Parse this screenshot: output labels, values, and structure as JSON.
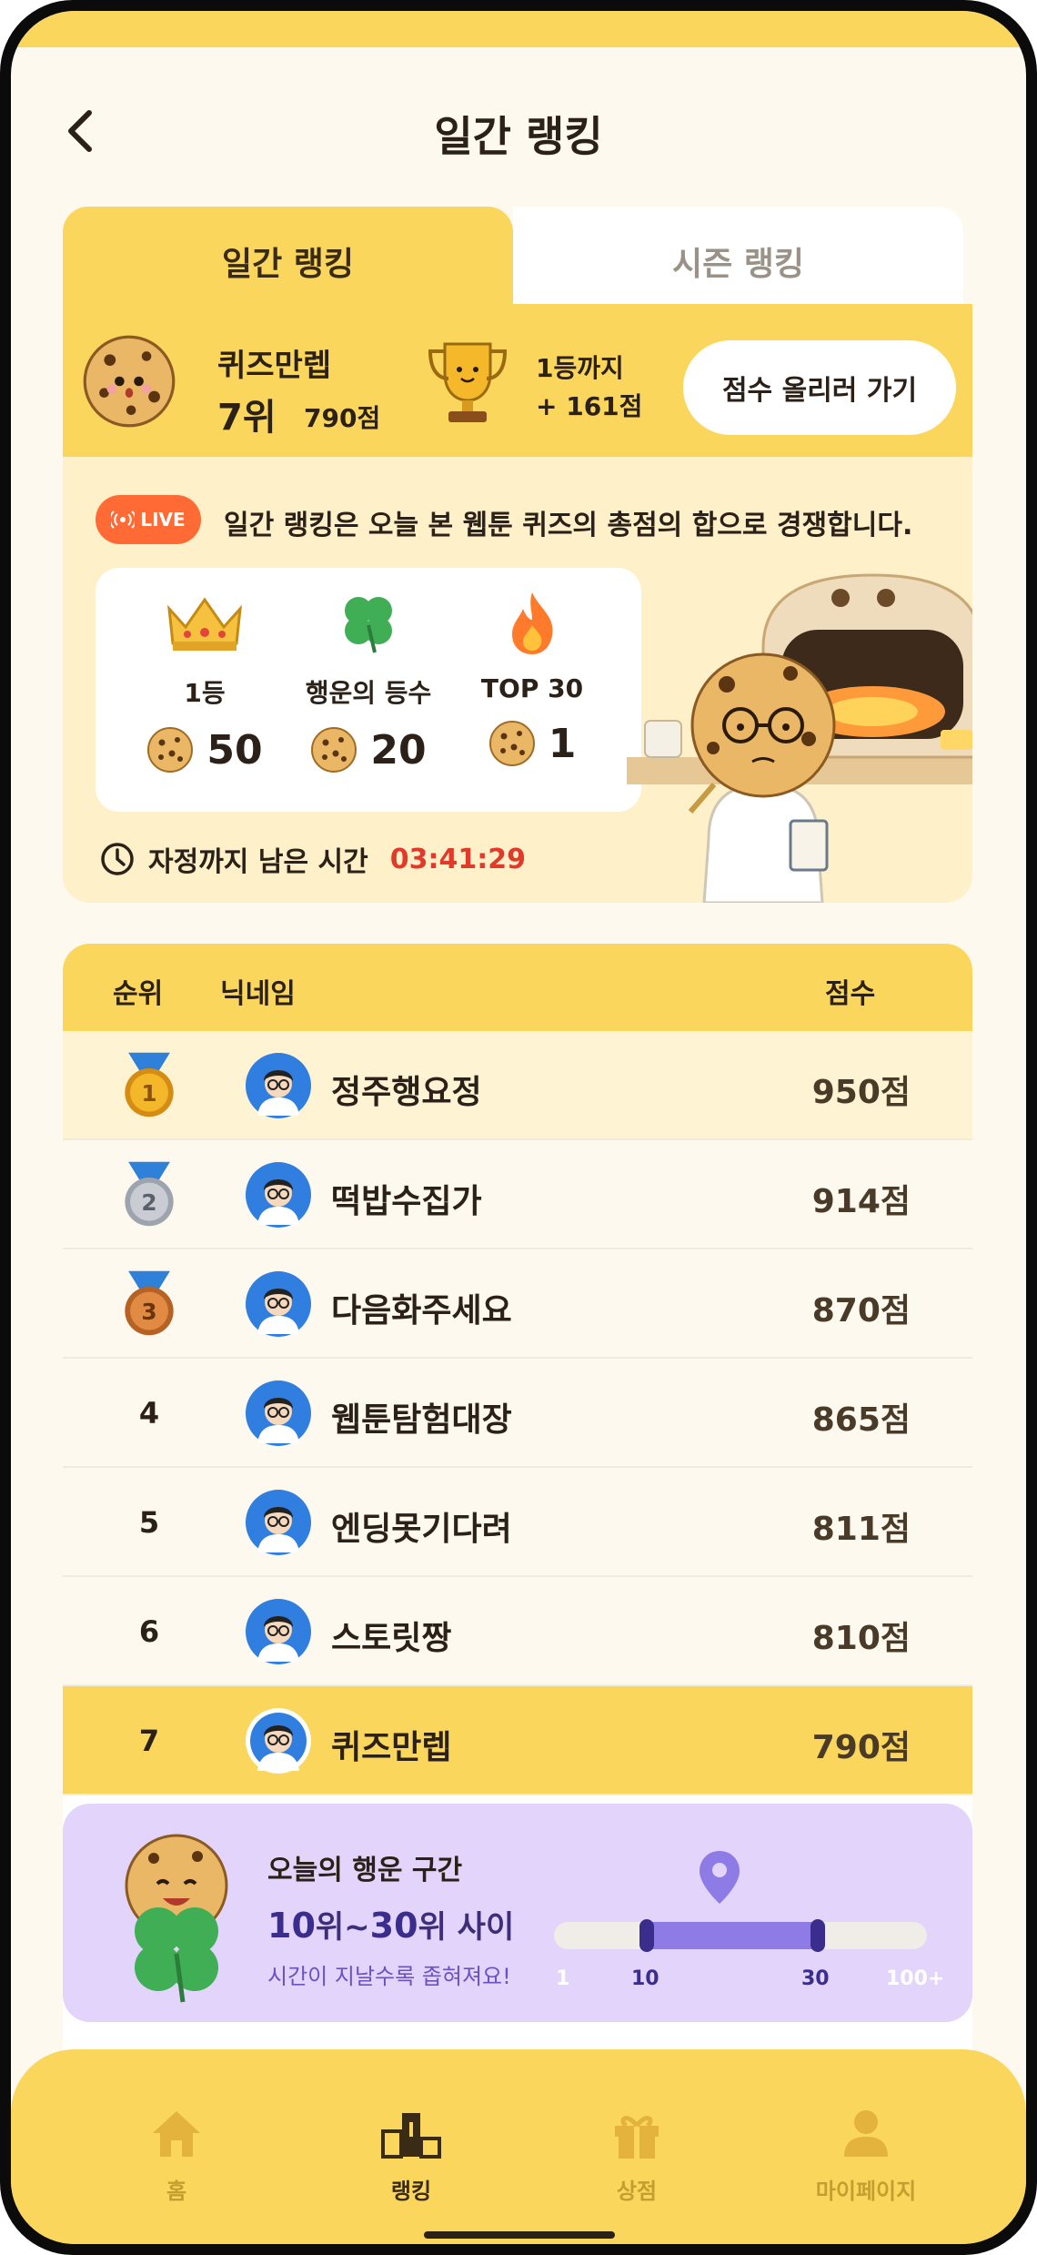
{
  "header": {
    "title": "일간 랭킹"
  },
  "tabs": [
    {
      "label": "일간 랭킹",
      "active": true
    },
    {
      "label": "시즌 랭킹",
      "active": false
    }
  ],
  "my_status": {
    "nickname": "퀴즈만렙",
    "rank": "7위",
    "score": "790점",
    "gap_line1": "1등까지",
    "gap_line2": "+ 161점",
    "cta": "점수 올리러 가기"
  },
  "info": {
    "live_badge": "LIVE",
    "description": "일간 랭킹은 오늘 본 웹툰 퀴즈의 총점의 합으로 경쟁합니다.",
    "rewards": [
      {
        "icon": "crown-icon",
        "label": "1등",
        "value": "50"
      },
      {
        "icon": "clover-icon",
        "label": "행운의 등수",
        "value": "20"
      },
      {
        "icon": "fire-icon",
        "label": "TOP 30",
        "value": "1"
      }
    ],
    "timer_label": "자정까지 남은 시간",
    "timer_value": "03:41:29"
  },
  "table": {
    "headers": {
      "rank": "순위",
      "nickname": "닉네임",
      "score": "점수"
    },
    "rows": [
      {
        "rank": "1",
        "nickname": "정주행요정",
        "score": "950점",
        "medal": "gold"
      },
      {
        "rank": "2",
        "nickname": "떡밥수집가",
        "score": "914점",
        "medal": "silver"
      },
      {
        "rank": "3",
        "nickname": "다음화주세요",
        "score": "870점",
        "medal": "bronze"
      },
      {
        "rank": "4",
        "nickname": "웹툰탐험대장",
        "score": "865점"
      },
      {
        "rank": "5",
        "nickname": "엔딩못기다려",
        "score": "811점"
      },
      {
        "rank": "6",
        "nickname": "스토릿짱",
        "score": "810점"
      },
      {
        "rank": "7",
        "nickname": "퀴즈만렙",
        "score": "790점",
        "is_me": true
      }
    ]
  },
  "lucky": {
    "title": "오늘의 행운 구간",
    "range_from": "10",
    "range_mid": "위~",
    "range_to": "30",
    "range_suffix": "위 사이",
    "subtitle": "시간이 지날수록 좁혀져요!",
    "ticks": [
      "1",
      "10",
      "30",
      "100+"
    ]
  },
  "nav": [
    {
      "label": "홈",
      "icon": "home-icon",
      "active": false
    },
    {
      "label": "랭킹",
      "icon": "podium-icon",
      "active": true
    },
    {
      "label": "상점",
      "icon": "gift-icon",
      "active": false
    },
    {
      "label": "마이페이지",
      "icon": "person-icon",
      "active": false
    }
  ],
  "colors": {
    "accent": "#fbd65c",
    "live": "#ff6a35",
    "timer": "#e23a2a",
    "lucky_bg": "#e2d4fb",
    "lucky_bar": "#8e7be6"
  }
}
